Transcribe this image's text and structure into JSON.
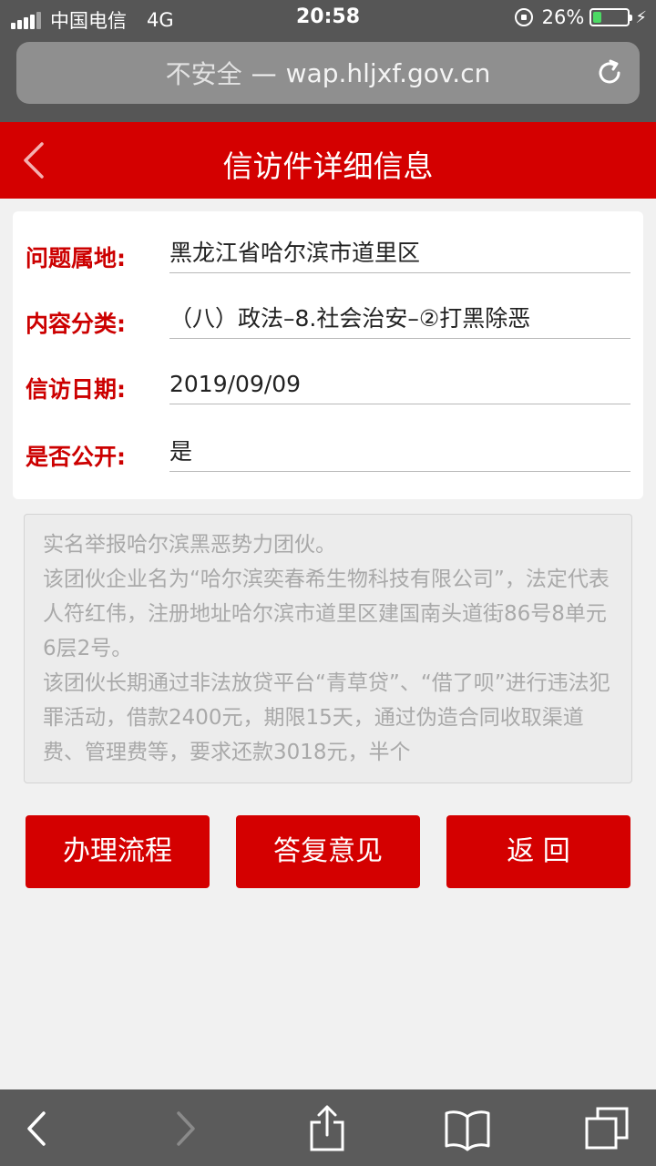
{
  "status_bar": {
    "carrier": "中国电信",
    "network": "4G",
    "time": "20:58",
    "battery_pct": "26%",
    "battery_level": 0.26
  },
  "url_bar": {
    "insecure_label": "不安全",
    "separator": "—",
    "domain": "wap.hljxf.gov.cn"
  },
  "header": {
    "title": "信访件详细信息"
  },
  "info": {
    "rows": [
      {
        "label": "问题属地:",
        "value": "黑龙江省哈尔滨市道里区"
      },
      {
        "label": "内容分类:",
        "value": "（八）政法–8.社会治安–②打黑除恶"
      },
      {
        "label": "信访日期:",
        "value": "2019/09/09"
      },
      {
        "label": "是否公开:",
        "value": "是"
      }
    ]
  },
  "content": {
    "paragraphs": [
      "实名举报哈尔滨黑恶势力团伙。",
      "该团伙企业名为“哈尔滨奕春希生物科技有限公司”，法定代表人符红伟，注册地址哈尔滨市道里区建国南头道街86号8单元6层2号。",
      "该团伙长期通过非法放贷平台“青草贷”、“借了呗”进行违法犯罪活动，借款2400元，期限15天，通过伪造合同收取渠道费、管理费等，要求还款3018元，半个"
    ]
  },
  "actions": {
    "process_label": "办理流程",
    "reply_label": "答复意见",
    "back_label": "返 回"
  },
  "colors": {
    "brand_red": "#d40000",
    "label_red": "#cc0000",
    "battery_green": "#4cd964"
  }
}
